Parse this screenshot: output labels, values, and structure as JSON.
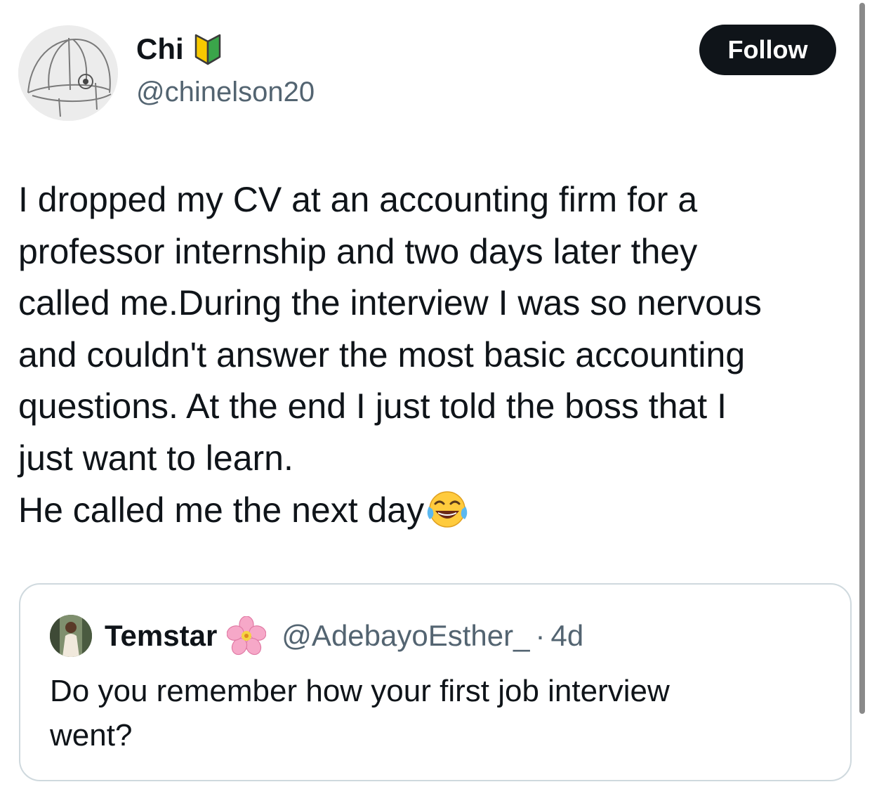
{
  "author": {
    "display_name": "Chi",
    "handle": "@chinelson20",
    "badge_icon": "beginner-shield-icon",
    "avatar_icon": "sketch-cage-avatar"
  },
  "follow_button": {
    "label": "Follow"
  },
  "tweet": {
    "lines": [
      "I dropped my CV at an accounting firm for a",
      "professor internship and two days later they",
      "called me.During the interview I was so nervous",
      "and couldn't answer the most basic accounting",
      "questions. At the end I just told the boss that I",
      "just want to learn.",
      "He called me the next day"
    ],
    "trailing_emoji": "tears-of-joy-emoji"
  },
  "quoted_tweet": {
    "display_name": "Temstar",
    "name_emoji": "cherry-blossom-emoji",
    "handle": "@AdebayoEsther_",
    "separator": "·",
    "time": "4d",
    "lines": [
      "Do you remember how your first job interview",
      "went?"
    ]
  },
  "colors": {
    "text": "#0f1419",
    "secondary_text": "#536471",
    "button_bg": "#0f1419",
    "card_border": "#cfd9de"
  }
}
